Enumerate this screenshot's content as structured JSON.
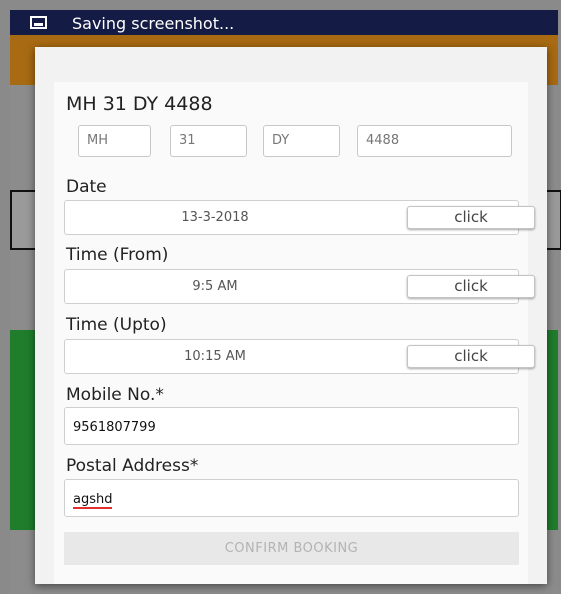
{
  "status_bar": {
    "text": "Saving screenshot...",
    "icon": "image-icon"
  },
  "dialog": {
    "vehicle_number": "MH 31 DY 4488",
    "plate_parts": [
      "MH",
      "31",
      "DY",
      "4488"
    ],
    "date": {
      "label": "Date",
      "value": "13-3-2018",
      "button": "click"
    },
    "time_from": {
      "label": "Time (From)",
      "value": "9:5 AM",
      "button": "click"
    },
    "time_upto": {
      "label": "Time (Upto)",
      "value": "10:15 AM",
      "button": "click"
    },
    "mobile": {
      "label": "Mobile No.*",
      "value": "9561807799"
    },
    "address": {
      "label": "Postal Address*",
      "value": "agshd"
    },
    "confirm_button": "CONFIRM BOOKING"
  },
  "colors": {
    "status_bar": "#141b45",
    "app_bar": "#a86a12",
    "background_green": "#1f7d2c"
  }
}
